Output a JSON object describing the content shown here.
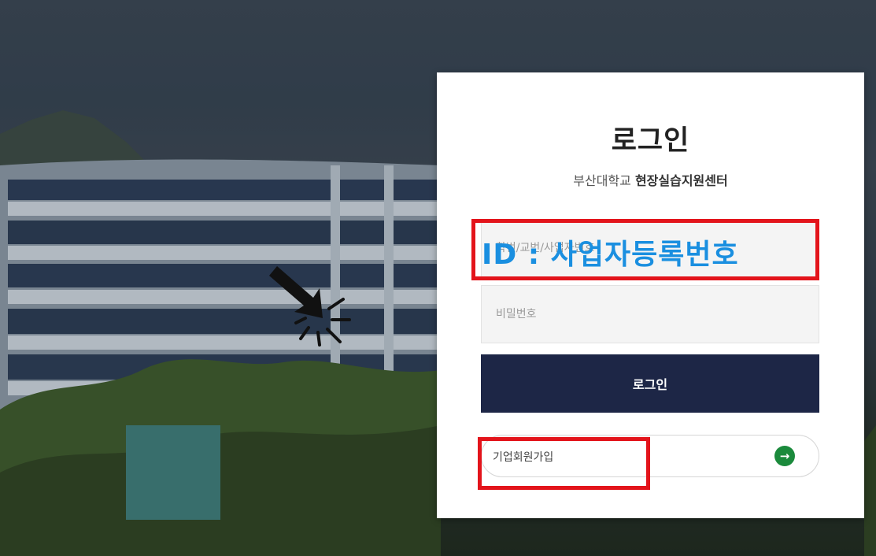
{
  "login": {
    "title": "로그인",
    "subtitle_prefix": "부산대학교 ",
    "subtitle_bold": "현장실습지원센터",
    "id_placeholder": "학번/교번/사업자번호",
    "password_placeholder": "비밀번호",
    "login_button": "로그인",
    "join_label": "기업회원가입"
  },
  "annotation": {
    "id_note": "ID : 사업자등록번호"
  },
  "colors": {
    "button_bg": "#1d2646",
    "join_arrow": "#1b8a3c",
    "highlight_box": "#e3141b",
    "note_text": "#1a8fe0"
  }
}
